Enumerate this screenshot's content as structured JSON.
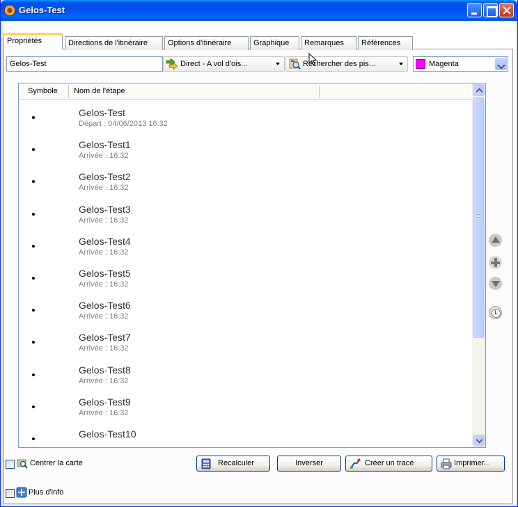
{
  "window": {
    "title": "Gelos-Test"
  },
  "tabs": [
    {
      "label": "Propriétés",
      "active": true
    },
    {
      "label": "Directions de l'itinéraire"
    },
    {
      "label": "Options d'itinéraire"
    },
    {
      "label": "Graphique"
    },
    {
      "label": "Remarques"
    },
    {
      "label": "Références"
    }
  ],
  "toolbar": {
    "route_name": "Gelos-Test",
    "routing_mode": "Direct - A vol d'ois...",
    "search": "Rechercher des pis...",
    "color": {
      "label": "Magenta",
      "hex": "#ff00ff"
    }
  },
  "list": {
    "columns": [
      "Symbole",
      "Nom de l'étape"
    ],
    "rows": [
      {
        "name": "Gelos-Test",
        "detail": "Départ : 04/06/2013 16:32"
      },
      {
        "name": "Gelos-Test1",
        "detail": "Arrivée : 16:32"
      },
      {
        "name": "Gelos-Test2",
        "detail": "Arrivée : 16:32"
      },
      {
        "name": "Gelos-Test3",
        "detail": "Arrivée : 16:32"
      },
      {
        "name": "Gelos-Test4",
        "detail": "Arrivée : 16:32"
      },
      {
        "name": "Gelos-Test5",
        "detail": "Arrivée : 16:32"
      },
      {
        "name": "Gelos-Test6",
        "detail": "Arrivée : 16:32"
      },
      {
        "name": "Gelos-Test7",
        "detail": "Arrivée : 16:32"
      },
      {
        "name": "Gelos-Test8",
        "detail": "Arrivée : 16:32"
      },
      {
        "name": "Gelos-Test9",
        "detail": "Arrivée : 16:32"
      },
      {
        "name": "Gelos-Test10",
        "detail": ""
      }
    ]
  },
  "bottom": {
    "center_map": "Centrer la carte",
    "more_info": "Plus d'info",
    "recalc": "Recalculer",
    "reverse": "Inverser",
    "create_track": "Créer un tracé",
    "print": "Imprimer..."
  }
}
